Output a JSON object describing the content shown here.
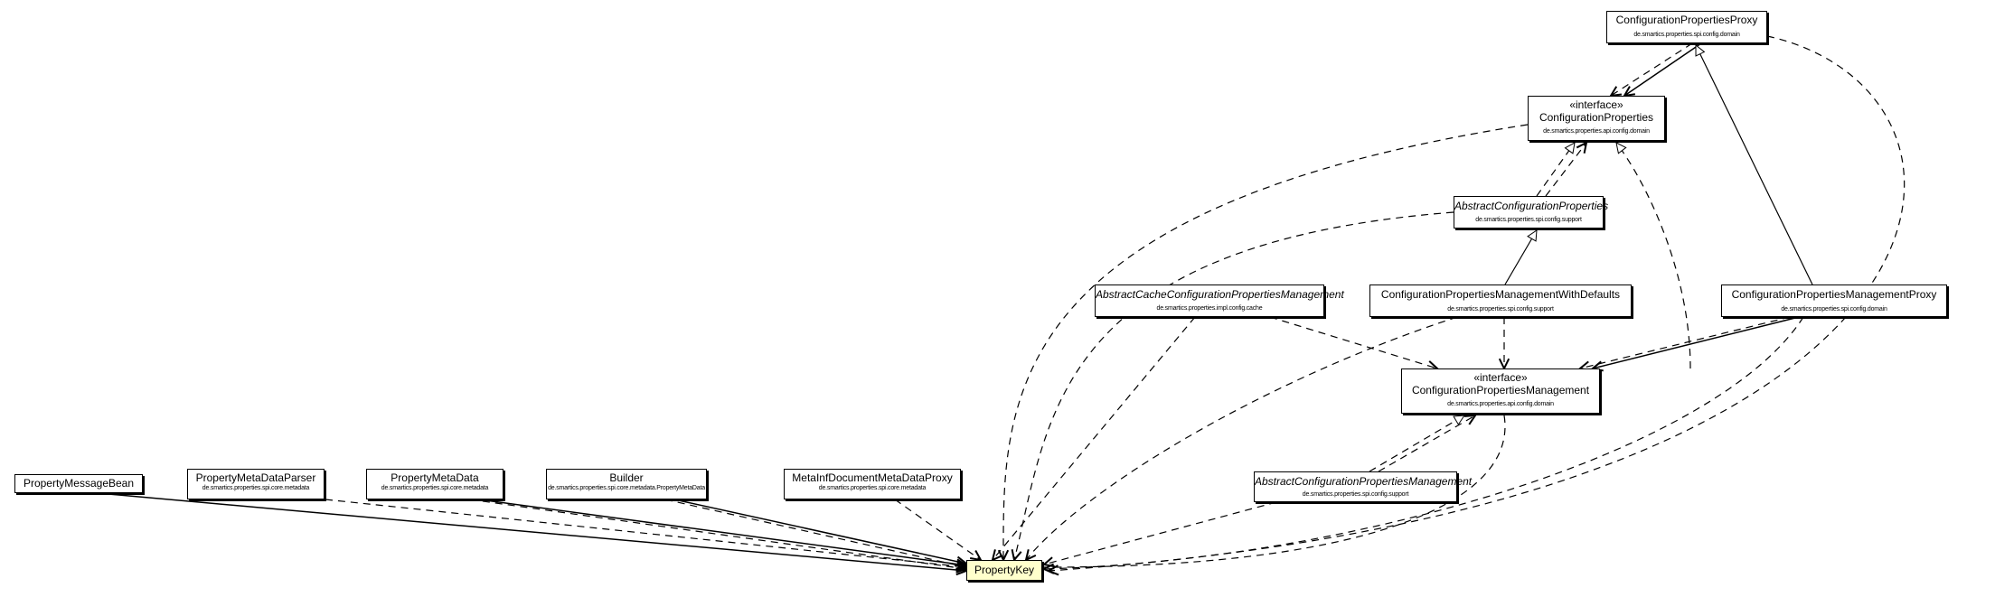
{
  "diagram": {
    "type": "uml-class-dependency",
    "focus_class": "PropertyKey",
    "colors": {
      "focus_fill": "#ffffcc",
      "node_fill": "#ffffff",
      "stroke": "#000000"
    },
    "nodes": [
      {
        "id": "cpProxy",
        "name": "ConfigurationPropertiesProxy",
        "package": "de.smartics.properties.spi.config.domain",
        "stereotype": "",
        "abstract": false
      },
      {
        "id": "cp",
        "name": "ConfigurationProperties",
        "package": "de.smartics.properties.api.config.domain",
        "stereotype": "«interface»",
        "abstract": false
      },
      {
        "id": "acp",
        "name": "AbstractConfigurationProperties",
        "package": "de.smartics.properties.spi.config.support",
        "stereotype": "",
        "abstract": true
      },
      {
        "id": "accpm",
        "name": "AbstractCacheConfigurationPropertiesManagement",
        "package": "de.smartics.properties.impl.config.cache",
        "stereotype": "",
        "abstract": true
      },
      {
        "id": "cpmwd",
        "name": "ConfigurationPropertiesManagementWithDefaults",
        "package": "de.smartics.properties.spi.config.support",
        "stereotype": "",
        "abstract": false
      },
      {
        "id": "cpmProxy",
        "name": "ConfigurationPropertiesManagementProxy",
        "package": "de.smartics.properties.spi.config.domain",
        "stereotype": "",
        "abstract": false
      },
      {
        "id": "cpm",
        "name": "ConfigurationPropertiesManagement",
        "package": "de.smartics.properties.api.config.domain",
        "stereotype": "«interface»",
        "abstract": false
      },
      {
        "id": "acpm",
        "name": "AbstractConfigurationPropertiesManagement",
        "package": "de.smartics.properties.spi.config.support",
        "stereotype": "",
        "abstract": true
      },
      {
        "id": "pmb",
        "name": "PropertyMessageBean",
        "package": "",
        "stereotype": "",
        "abstract": false
      },
      {
        "id": "pmdp",
        "name": "PropertyMetaDataParser",
        "package": "de.smartics.properties.spi.core.metadata",
        "stereotype": "",
        "abstract": false
      },
      {
        "id": "pmd",
        "name": "PropertyMetaData",
        "package": "de.smartics.properties.spi.core.metadata",
        "stereotype": "",
        "abstract": false
      },
      {
        "id": "builder",
        "name": "Builder",
        "package": "de.smartics.properties.spi.core.metadata.PropertyMetaData",
        "stereotype": "",
        "abstract": false
      },
      {
        "id": "midmdp",
        "name": "MetaInfDocumentMetaDataProxy",
        "package": "de.smartics.properties.spi.core.metadata",
        "stereotype": "",
        "abstract": false
      },
      {
        "id": "pk",
        "name": "PropertyKey",
        "package": "",
        "stereotype": "",
        "abstract": false
      }
    ],
    "edges": [
      {
        "from": "cpProxy",
        "to": "cp",
        "kind": "dependency"
      },
      {
        "from": "cpProxy",
        "to": "cp",
        "kind": "association"
      },
      {
        "from": "cpmProxy",
        "to": "cpProxy",
        "kind": "generalization"
      },
      {
        "from": "cpProxy",
        "to": "pk",
        "kind": "dependency"
      },
      {
        "from": "acp",
        "to": "cp",
        "kind": "realization"
      },
      {
        "from": "acp",
        "to": "cp",
        "kind": "dependency"
      },
      {
        "from": "cpm",
        "to": "cp",
        "kind": "realization"
      },
      {
        "from": "cp",
        "to": "pk",
        "kind": "dependency"
      },
      {
        "from": "acp",
        "to": "pk",
        "kind": "dependency"
      },
      {
        "from": "cpmwd",
        "to": "acp",
        "kind": "generalization"
      },
      {
        "from": "accpm",
        "to": "cpm",
        "kind": "dependency"
      },
      {
        "from": "accpm",
        "to": "pk",
        "kind": "dependency"
      },
      {
        "from": "cpmwd",
        "to": "cpm",
        "kind": "dependency"
      },
      {
        "from": "cpmwd",
        "to": "pk",
        "kind": "dependency"
      },
      {
        "from": "cpmProxy",
        "to": "cpm",
        "kind": "dependency"
      },
      {
        "from": "cpmProxy",
        "to": "cpm",
        "kind": "association"
      },
      {
        "from": "cpmProxy",
        "to": "pk",
        "kind": "dependency"
      },
      {
        "from": "acpm",
        "to": "cpm",
        "kind": "realization"
      },
      {
        "from": "acpm",
        "to": "cpm",
        "kind": "dependency"
      },
      {
        "from": "cpm",
        "to": "pk",
        "kind": "dependency"
      },
      {
        "from": "acpm",
        "to": "pk",
        "kind": "dependency"
      },
      {
        "from": "pmb",
        "to": "pk",
        "kind": "association"
      },
      {
        "from": "pmdp",
        "to": "pk",
        "kind": "dependency"
      },
      {
        "from": "pmd",
        "to": "pk",
        "kind": "association"
      },
      {
        "from": "pmd",
        "to": "pk",
        "kind": "dependency"
      },
      {
        "from": "builder",
        "to": "pk",
        "kind": "association"
      },
      {
        "from": "builder",
        "to": "pk",
        "kind": "dependency"
      },
      {
        "from": "midmdp",
        "to": "pk",
        "kind": "dependency"
      }
    ]
  }
}
